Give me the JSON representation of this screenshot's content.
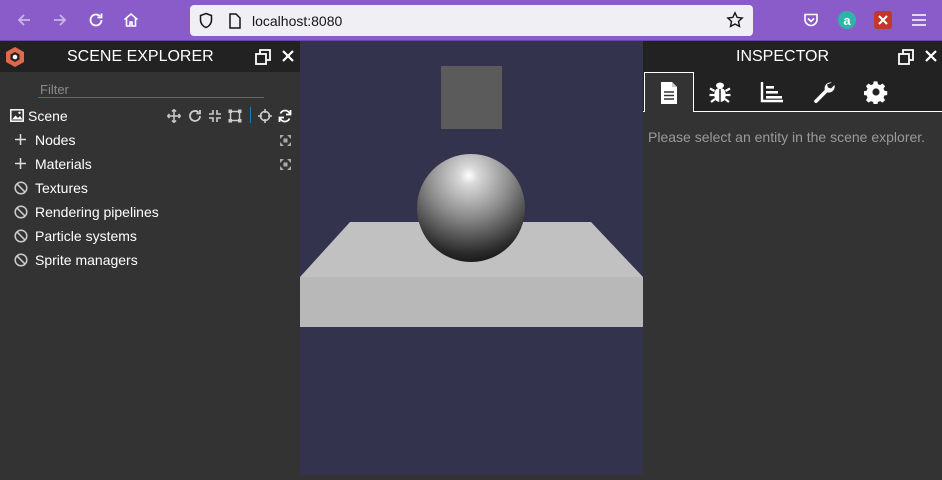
{
  "browser": {
    "url": "localhost:8080",
    "accent": "#8a5cc9",
    "extension_letter": "a"
  },
  "scene_explorer": {
    "title": "SCENE EXPLORER",
    "filter_placeholder": "Filter",
    "scene_label": "Scene",
    "items": [
      {
        "label": "Nodes",
        "icon": "plus-icon",
        "expandable": true
      },
      {
        "label": "Materials",
        "icon": "plus-icon",
        "expandable": true
      },
      {
        "label": "Textures",
        "icon": "disabled-icon",
        "expandable": false
      },
      {
        "label": "Rendering pipelines",
        "icon": "disabled-icon",
        "expandable": false
      },
      {
        "label": "Particle systems",
        "icon": "disabled-icon",
        "expandable": false
      },
      {
        "label": "Sprite managers",
        "icon": "disabled-icon",
        "expandable": false
      }
    ]
  },
  "viewport": {
    "background": "#33334d",
    "objects": [
      "box",
      "sphere",
      "ground-plane"
    ]
  },
  "inspector": {
    "title": "INSPECTOR",
    "tabs": [
      "properties-tab",
      "debug-tab",
      "statistics-tab",
      "tools-tab",
      "settings-tab"
    ],
    "active_tab": "properties-tab",
    "empty_message": "Please select an entity in the scene explorer."
  }
}
